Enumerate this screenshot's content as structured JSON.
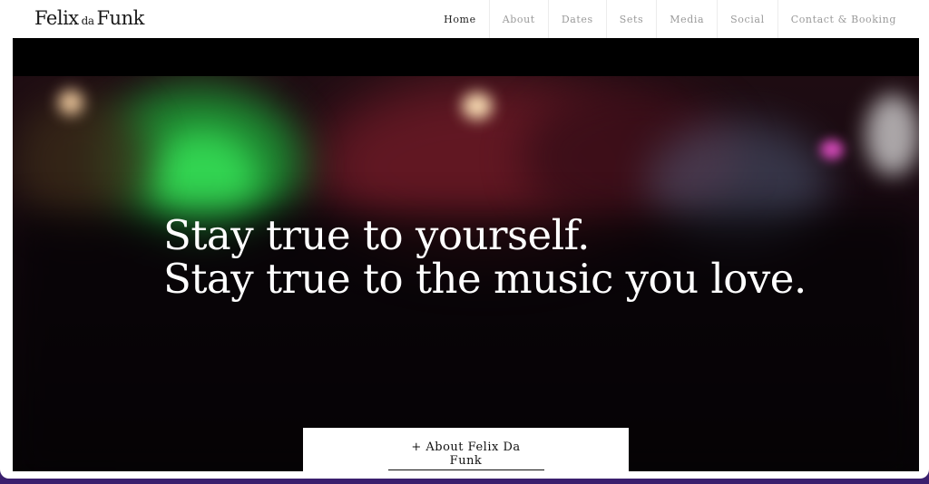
{
  "brand": {
    "logo_part1": "Felix",
    "logo_part2": "da",
    "logo_part3": "Funk"
  },
  "nav": {
    "items": [
      {
        "label": "Home",
        "active": true
      },
      {
        "label": "About",
        "active": false
      },
      {
        "label": "Dates",
        "active": false
      },
      {
        "label": "Sets",
        "active": false
      },
      {
        "label": "Media",
        "active": false
      },
      {
        "label": "Social",
        "active": false
      },
      {
        "label": "Contact & Booking",
        "active": false
      }
    ]
  },
  "hero": {
    "line1": "Stay true to yourself.",
    "line2": "Stay true to the music you love.",
    "cta_label": "+ About Felix Da Funk"
  },
  "colors": {
    "accent_green": "#2fd84a",
    "accent_pink": "#e64fc8",
    "wall_red": "#7a1e2a",
    "frame_bg": "#3a1f6e"
  }
}
